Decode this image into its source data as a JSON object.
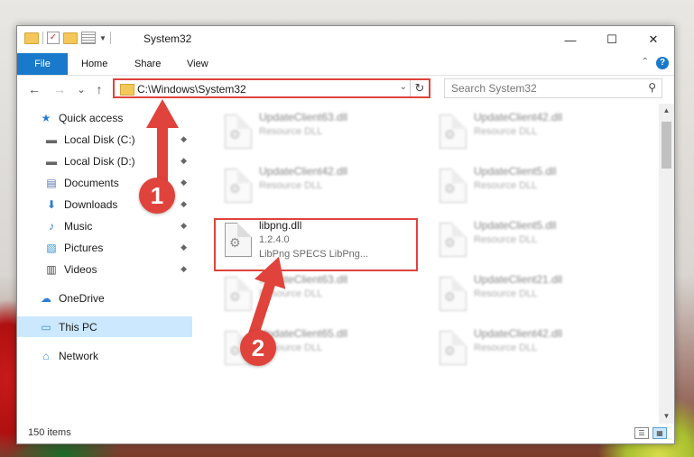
{
  "window": {
    "title": "System32",
    "controls": {
      "minimize": "—",
      "maximize": "☐",
      "close": "✕"
    }
  },
  "ribbon": {
    "tabs": [
      "File",
      "Home",
      "Share",
      "View"
    ],
    "help_label": "?"
  },
  "navigation": {
    "back_glyph": "←",
    "forward_glyph": "→",
    "recent_glyph": "⌄",
    "up_glyph": "↑"
  },
  "address_bar": {
    "path": "C:\\Windows\\System32",
    "dropdown_glyph": "⌄",
    "refresh_glyph": "↻"
  },
  "search": {
    "placeholder": "Search System32",
    "icon_glyph": "⚲"
  },
  "sidebar": {
    "items": [
      {
        "label": "Quick access",
        "icon": "star-icon",
        "glyph": "★",
        "color": "#2b7bd6",
        "pinned": false,
        "selected": false
      },
      {
        "label": "Local Disk (C:)",
        "icon": "drive-icon",
        "glyph": "▬",
        "color": "#666666",
        "pinned": true,
        "selected": false
      },
      {
        "label": "Local Disk (D:)",
        "icon": "drive-icon",
        "glyph": "▬",
        "color": "#666666",
        "pinned": true,
        "selected": false
      },
      {
        "label": "Documents",
        "icon": "documents-icon",
        "glyph": "▤",
        "color": "#5577aa",
        "pinned": true,
        "selected": false
      },
      {
        "label": "Downloads",
        "icon": "downloads-icon",
        "glyph": "⬇",
        "color": "#2b7bd6",
        "pinned": true,
        "selected": false
      },
      {
        "label": "Music",
        "icon": "music-icon",
        "glyph": "♪",
        "color": "#2b7bd6",
        "pinned": true,
        "selected": false
      },
      {
        "label": "Pictures",
        "icon": "pictures-icon",
        "glyph": "▧",
        "color": "#3a8fd0",
        "pinned": true,
        "selected": false
      },
      {
        "label": "Videos",
        "icon": "videos-icon",
        "glyph": "▥",
        "color": "#444444",
        "pinned": true,
        "selected": false
      },
      {
        "label": "OneDrive",
        "icon": "cloud-icon",
        "glyph": "☁",
        "color": "#2b7bd6",
        "pinned": false,
        "selected": false
      },
      {
        "label": "This PC",
        "icon": "computer-icon",
        "glyph": "▭",
        "color": "#3a8fd0",
        "pinned": false,
        "selected": true
      },
      {
        "label": "Network",
        "icon": "network-icon",
        "glyph": "⌂",
        "color": "#3a8fd0",
        "pinned": false,
        "selected": false
      }
    ],
    "pin_glyph": "📌"
  },
  "files": [
    {
      "name": "UpdateClient63.dll",
      "line2": "Resource DLL",
      "line3": "",
      "blurred": true
    },
    {
      "name": "UpdateClient42.dll",
      "line2": "Resource DLL",
      "line3": "",
      "blurred": true
    },
    {
      "name": "UpdateClient42.dll",
      "line2": "Resource DLL",
      "line3": "",
      "blurred": true
    },
    {
      "name": "UpdateClient5.dll",
      "line2": "Resource DLL",
      "line3": "",
      "blurred": true
    },
    {
      "name": "libpng.dll",
      "line2": "1.2.4.0",
      "line3": "LibPng SPECS LibPng...",
      "blurred": false
    },
    {
      "name": "UpdateClient5.dll",
      "line2": "Resource DLL",
      "line3": "",
      "blurred": true
    },
    {
      "name": "UpdateClient63.dll",
      "line2": "Resource DLL",
      "line3": "",
      "blurred": true
    },
    {
      "name": "UpdateClient21.dll",
      "line2": "Resource DLL",
      "line3": "",
      "blurred": true
    },
    {
      "name": "UpdateClient65.dll",
      "line2": "Resource DLL",
      "line3": "",
      "blurred": true
    },
    {
      "name": "UpdateClient42.dll",
      "line2": "Resource DLL",
      "line3": "",
      "blurred": true
    }
  ],
  "file_icon_glyph": "⚙",
  "scrollbar": {
    "up_glyph": "▲",
    "down_glyph": "▼",
    "position_fraction": 0.0
  },
  "status": {
    "item_count": "150 items",
    "view_details_glyph": "☰",
    "view_tiles_glyph": "▦"
  },
  "annotations": [
    {
      "number": "1",
      "color": "#e0433b"
    },
    {
      "number": "2",
      "color": "#e0433b"
    }
  ]
}
